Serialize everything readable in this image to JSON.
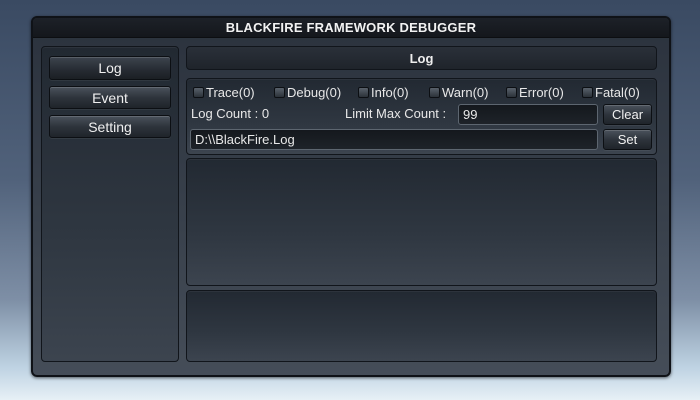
{
  "window": {
    "title": "BLACKFIRE FRAMEWORK DEBUGGER"
  },
  "sidebar": {
    "buttons": [
      {
        "label": "Log"
      },
      {
        "label": "Event"
      },
      {
        "label": "Setting"
      }
    ]
  },
  "main": {
    "header": "Log",
    "filters": [
      {
        "label": "Trace(0)"
      },
      {
        "label": "Debug(0)"
      },
      {
        "label": "Info(0)"
      },
      {
        "label": "Warn(0)"
      },
      {
        "label": "Error(0)"
      },
      {
        "label": "Fatal(0)"
      }
    ],
    "log_count_label": "Log Count : 0",
    "limit_label": "Limit Max Count :",
    "limit_value": "99",
    "clear_label": "Clear",
    "path_value": "D:\\\\BlackFire.Log",
    "set_label": "Set"
  }
}
